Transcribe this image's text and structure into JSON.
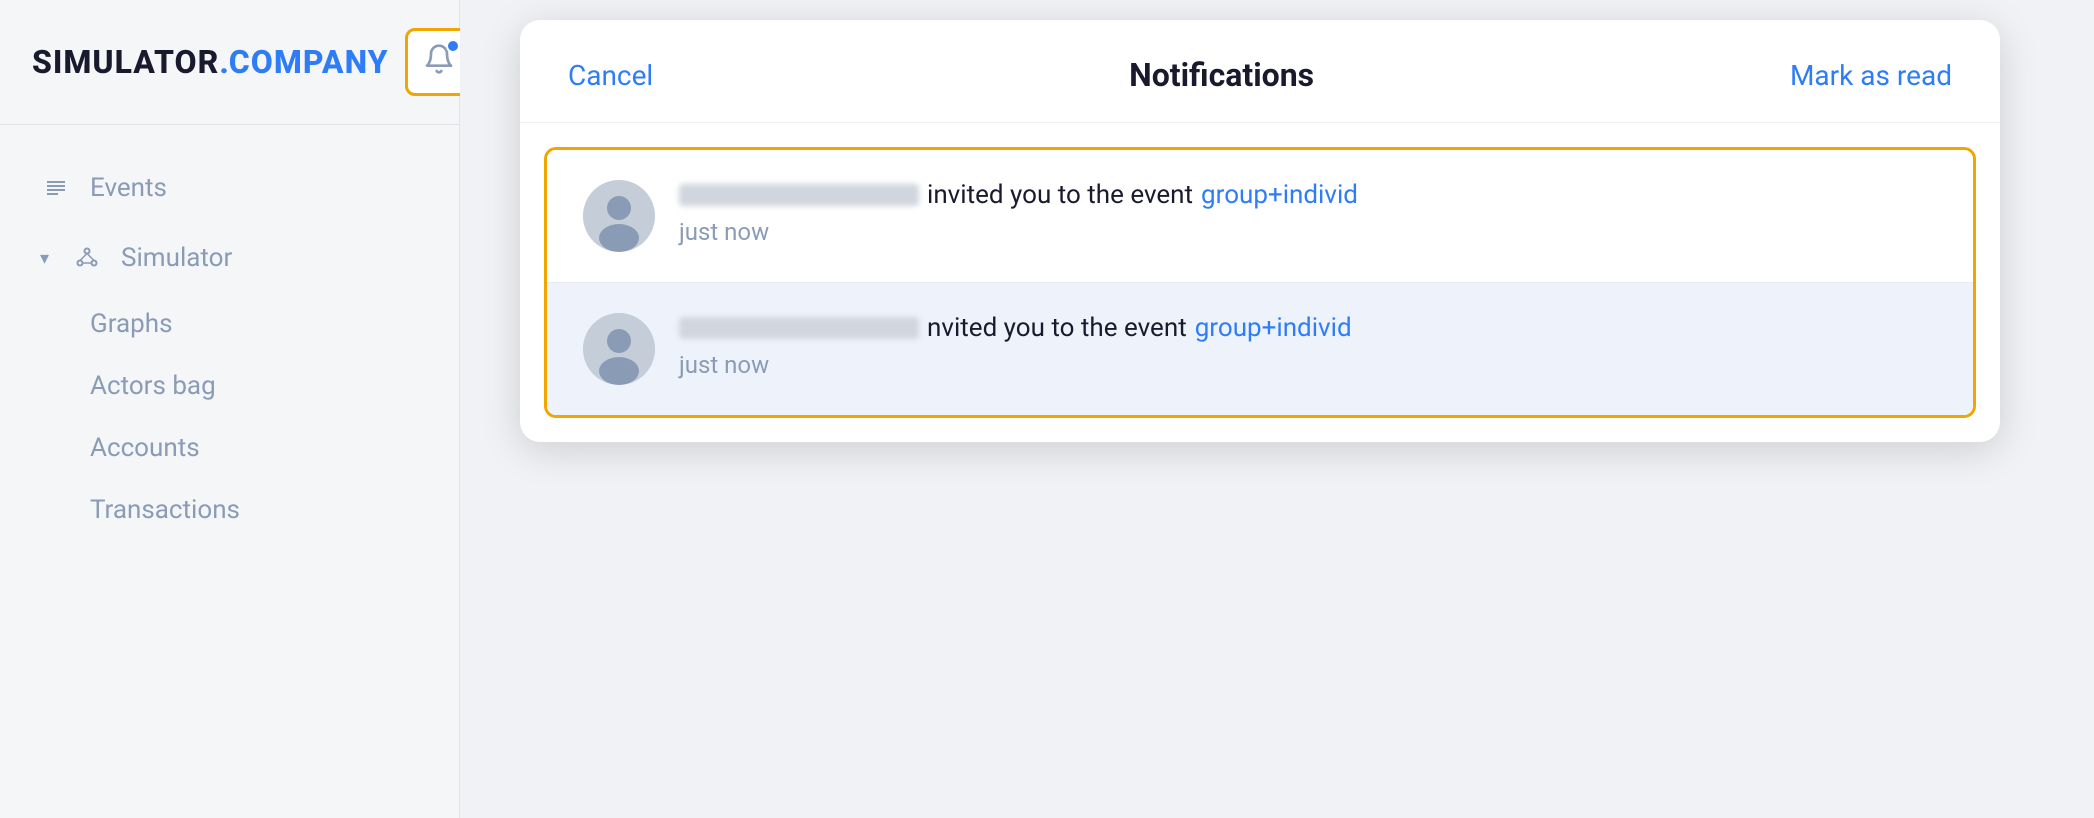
{
  "logo": {
    "simulator": "SIMULATOR",
    "dot": ".",
    "company": "COMPANY"
  },
  "sidebar": {
    "nav_items": [
      {
        "id": "events",
        "label": "Events",
        "icon": "list",
        "has_arrow": false,
        "is_sub": false
      },
      {
        "id": "simulator",
        "label": "Simulator",
        "icon": "nodes",
        "has_arrow": true,
        "is_sub": false
      },
      {
        "id": "graphs",
        "label": "Graphs",
        "is_sub": true
      },
      {
        "id": "actors-bag",
        "label": "Actors bag",
        "is_sub": true
      },
      {
        "id": "accounts",
        "label": "Accounts",
        "is_sub": true
      },
      {
        "id": "transactions",
        "label": "Transactions",
        "is_sub": true
      }
    ]
  },
  "notifications_panel": {
    "cancel_label": "Cancel",
    "title": "Notifications",
    "mark_read_label": "Mark as read",
    "notifications": [
      {
        "id": 1,
        "username_blurred": true,
        "message": "invited you to the event",
        "event_link": "group+individ",
        "time": "just now",
        "unread": false
      },
      {
        "id": 2,
        "username_blurred": true,
        "message": "nvited you to the event",
        "event_link": "group+individ",
        "time": "just now",
        "unread": true
      }
    ]
  }
}
